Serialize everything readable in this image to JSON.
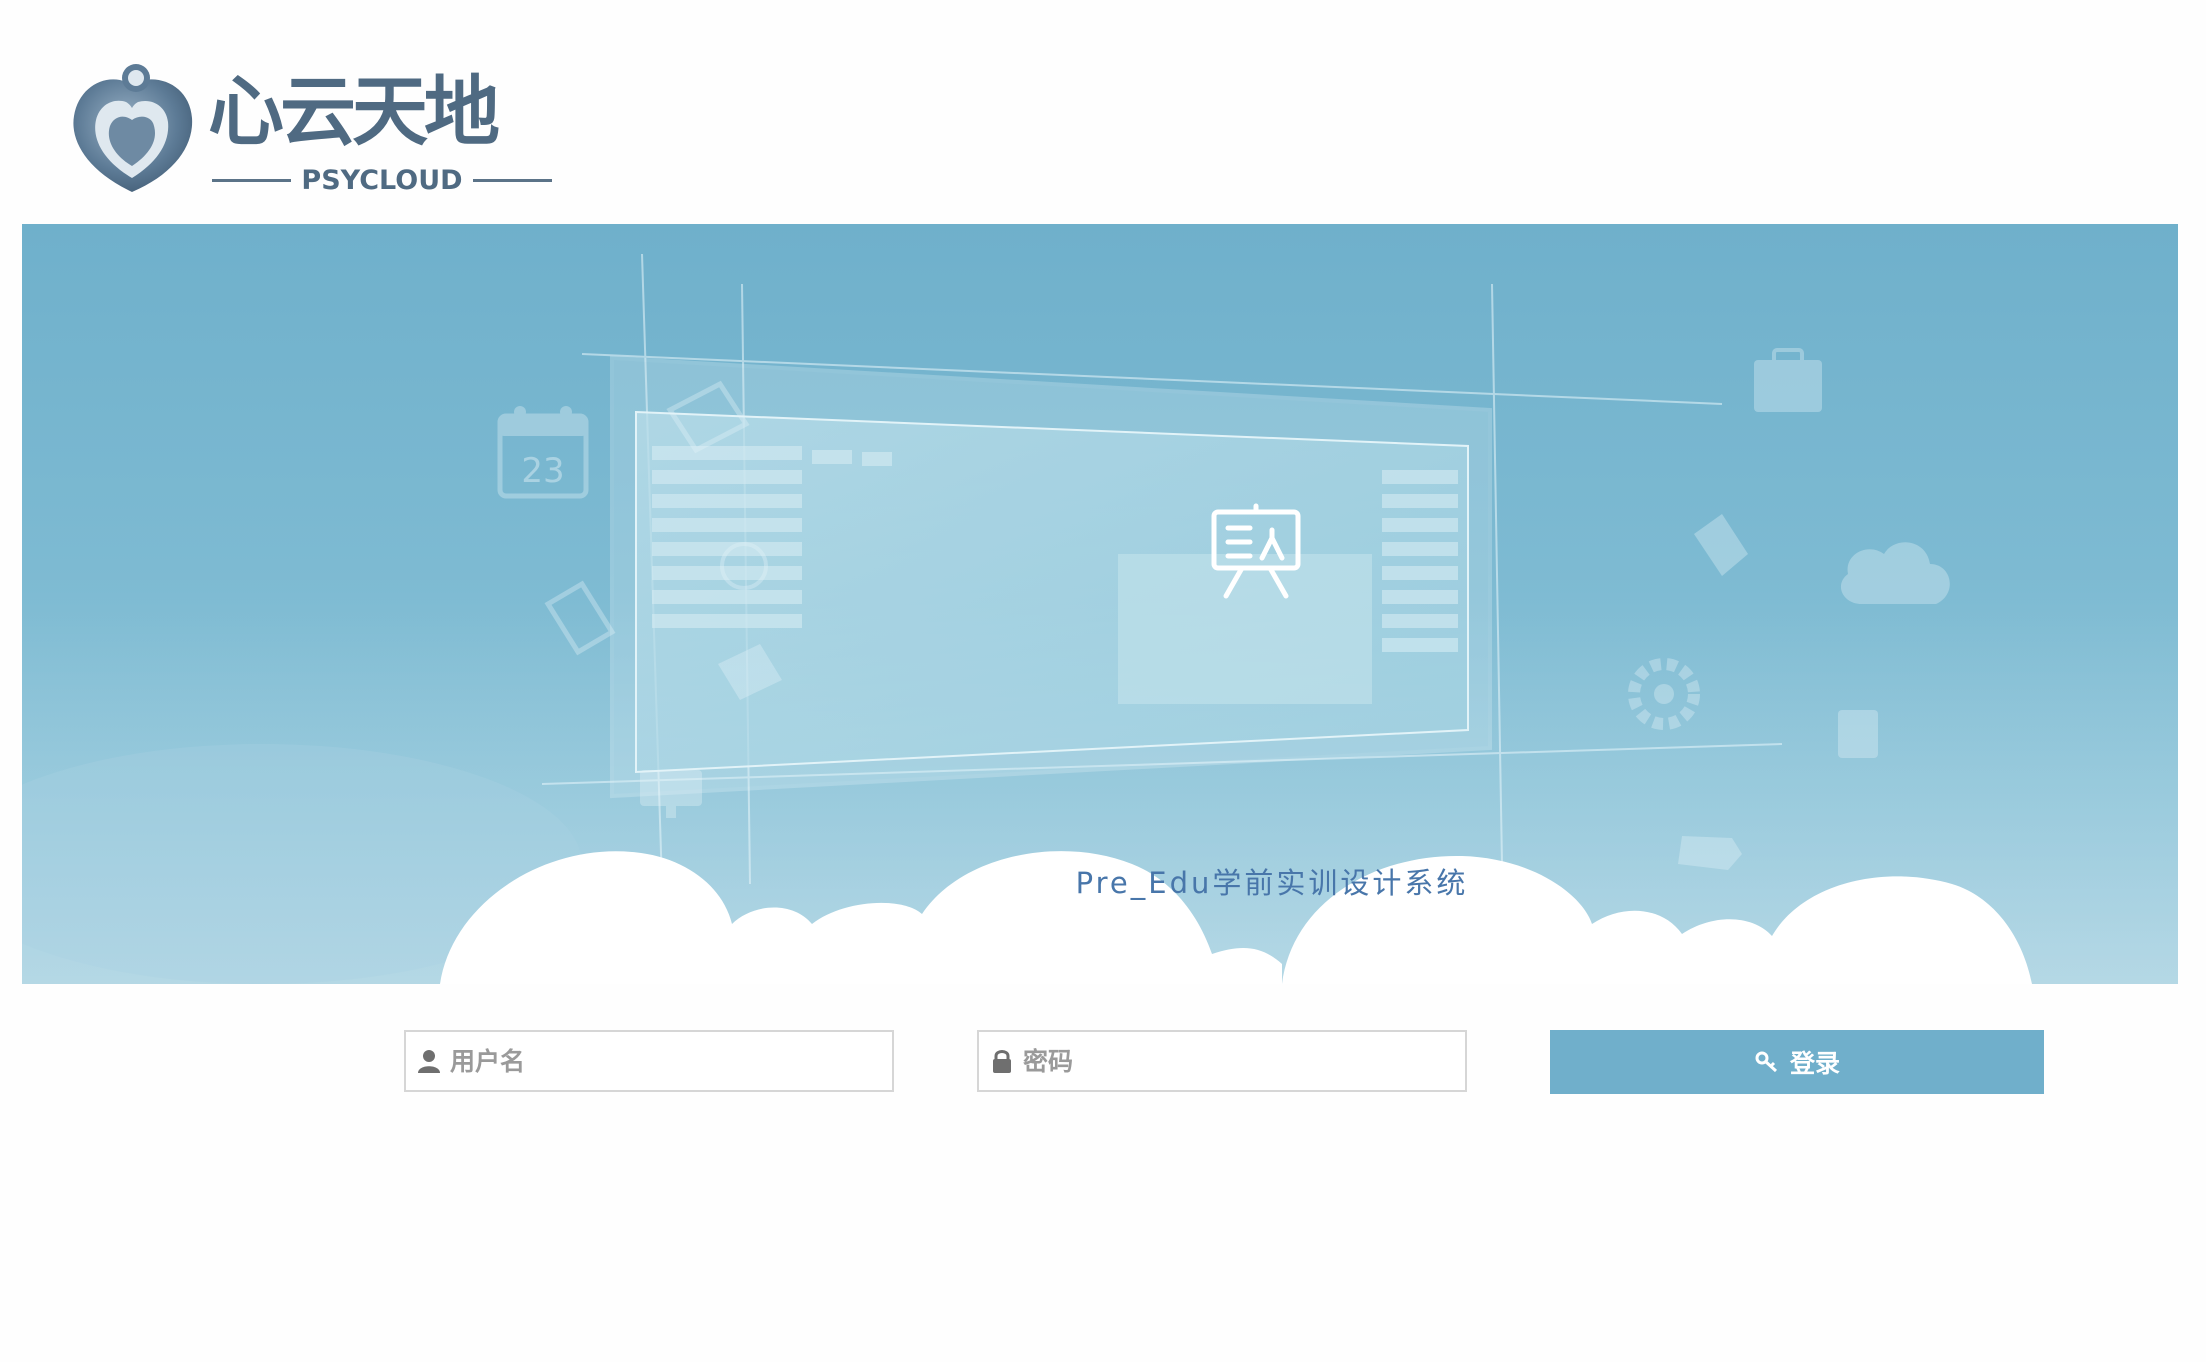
{
  "logo": {
    "name_cn": "心云天地",
    "name_en": "PSYCLOUD"
  },
  "banner": {
    "title": "Pre_Edu学前实训设计系统",
    "calendar_day": "23"
  },
  "form": {
    "username_placeholder": "用户名",
    "password_placeholder": "密码",
    "login_label": "登录"
  },
  "colors": {
    "brand": "#4f6a82",
    "banner": "#7dbad2",
    "button": "#70afcb",
    "title_text": "#4876aa"
  }
}
